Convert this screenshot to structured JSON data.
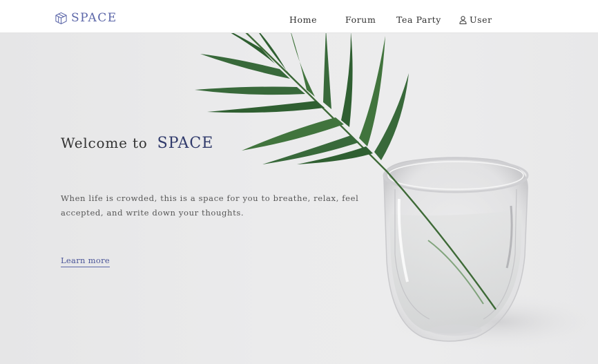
{
  "header": {
    "brand": "SPACE",
    "logo_icon": "cube-icon",
    "nav": {
      "home": "Home",
      "forum": "Forum",
      "tea_party": "Tea Party",
      "user": "User",
      "user_icon": "user-icon"
    }
  },
  "hero": {
    "welcome_prefix": "Welcome to",
    "welcome_brand": "SPACE",
    "tagline_line1": "When life is crowded, this is a space for you to breathe, relax, feel",
    "tagline_line2": "accepted, and write down your thoughts.",
    "learn_more": "Learn more",
    "photo": "palm-leaf-in-glass-of-water"
  },
  "colors": {
    "brand": "#5b66a8",
    "brand_highlight": "#a8b4e4",
    "background": "#e9e9ea",
    "header_bg": "#ffffff",
    "text": "#333333"
  }
}
